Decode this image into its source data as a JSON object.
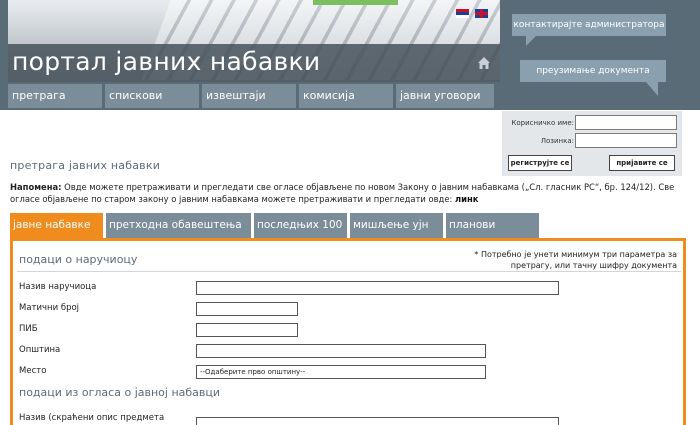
{
  "header": {
    "title": "портал јавних набавки",
    "home_icon": "home-icon",
    "flags": [
      "serbian-flag-icon",
      "uk-flag-icon"
    ]
  },
  "topnav": {
    "items": [
      {
        "label": "претрага"
      },
      {
        "label": "спискови"
      },
      {
        "label": "извештаји"
      },
      {
        "label": "комисија"
      },
      {
        "label": "јавни уговори"
      }
    ]
  },
  "right_panel": {
    "contact_admin": "контактирајте администратора",
    "download_docs": "преузимање документа"
  },
  "login": {
    "username_label": "Корисничко име:",
    "username_value": "",
    "password_label": "Лозинка:",
    "password_value": "",
    "register_label": "региструјте се",
    "login_label": "пријавите се"
  },
  "page": {
    "title": "претрага јавних набавки",
    "notice_bold": "Напомена:",
    "notice_text": " Овде можете претраживати и прегледати све огласе објављене по новом Закону о јавним набавкама („Сл. гласник РС“, бр. 124/12). Све огласе објављене по старом закону о јавним набавкама можете претраживати и прегледати овде: ",
    "notice_link": "линк"
  },
  "search_tabs": [
    {
      "label": "јавне набавке"
    },
    {
      "label": "претходна обавештења"
    },
    {
      "label": "последњих 100"
    },
    {
      "label": "мишљење ујн"
    },
    {
      "label": "планови"
    }
  ],
  "form": {
    "section1_title": "подаци о наручиоцу",
    "required_note": "* Потребно је унети минимум три параметра за претрагу, или тачну шифру документа",
    "fields": [
      {
        "label": "Назив наручиоца",
        "value": ""
      },
      {
        "label": "Матични број",
        "value": ""
      },
      {
        "label": "ПИБ",
        "value": ""
      },
      {
        "label": "Општина",
        "value": ""
      },
      {
        "label": "Место",
        "value": "--Одаберите прво општину--"
      }
    ],
    "section2_title": "подаци из огласа о јавној набавци",
    "field2_label": "Назив (скраћени опис предмета"
  },
  "colors": {
    "accent": "#f08c1e",
    "nav": "#7b8d99",
    "header": "#5a6b78"
  }
}
